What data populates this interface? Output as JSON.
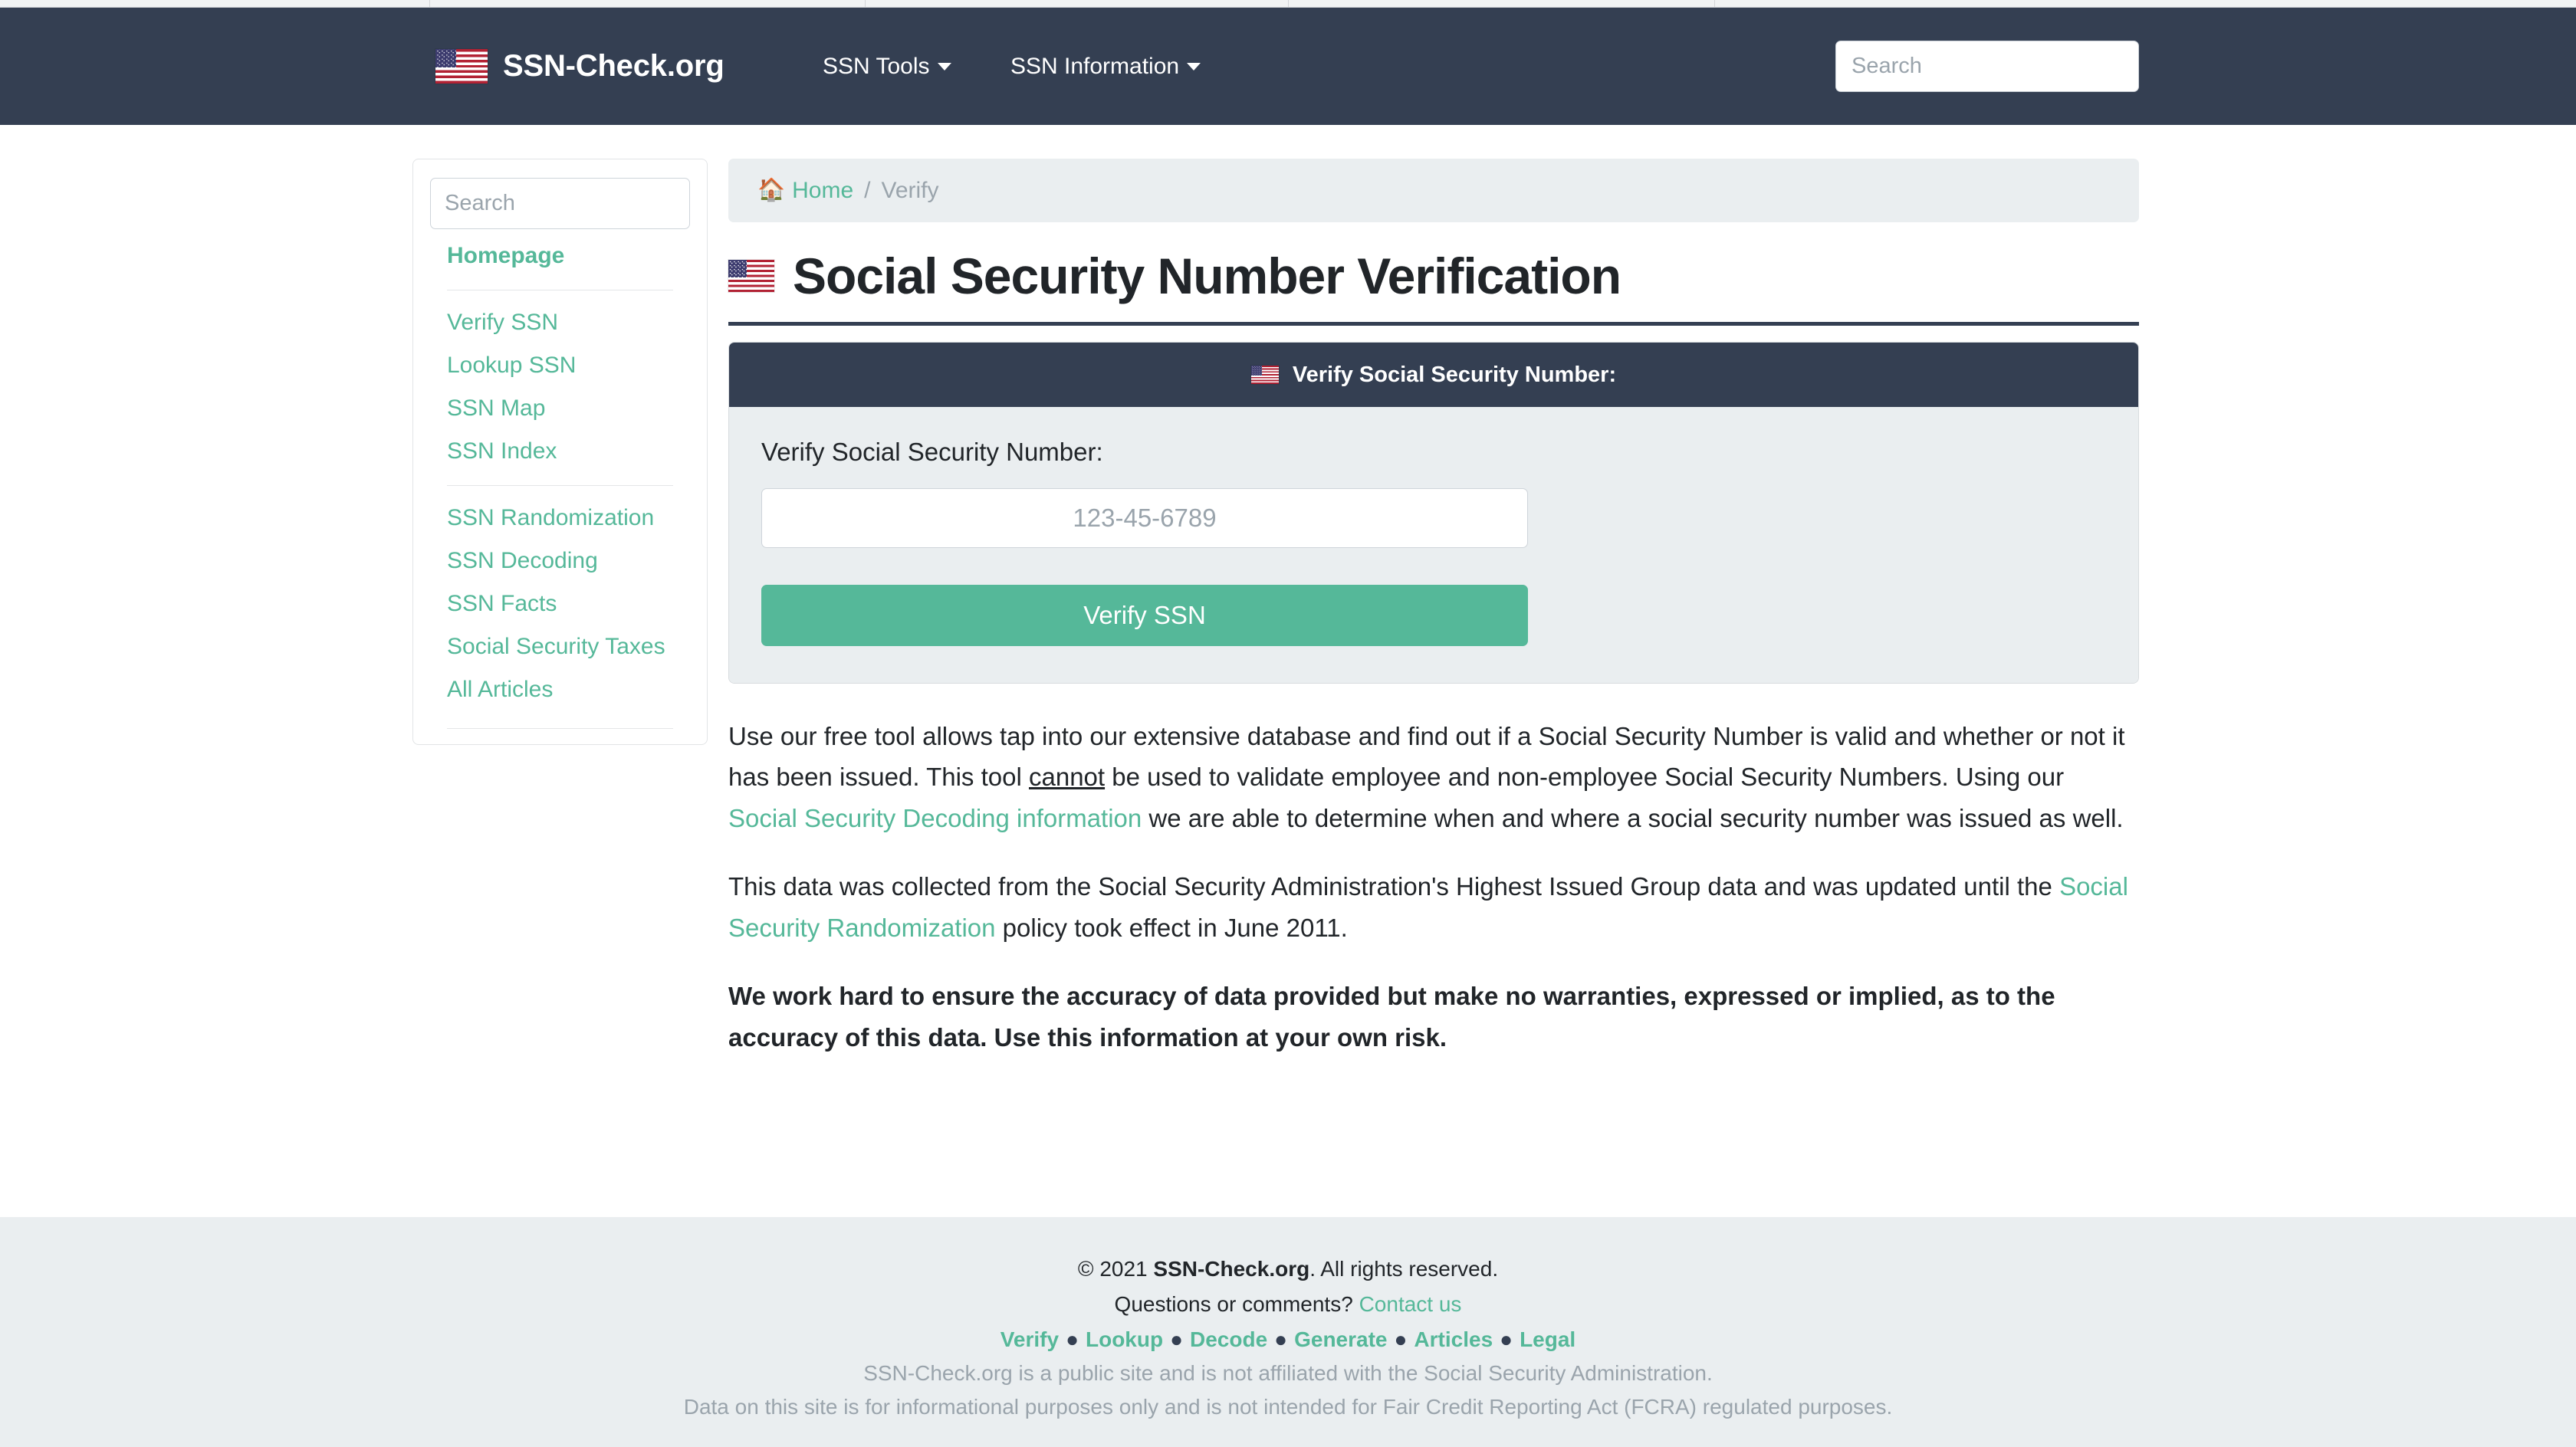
{
  "browser": {
    "tab_dividers": [
      560,
      1128,
      1680,
      2236
    ]
  },
  "navbar": {
    "brand": "SSN-Check.org",
    "brand_flag_icon": "us-flag-icon",
    "items": [
      {
        "label": "SSN Tools",
        "caret": "chevron-down-icon"
      },
      {
        "label": "SSN Information",
        "caret": "chevron-down-icon"
      }
    ],
    "search_placeholder": "Search",
    "search_value": "",
    "background": "#343f52"
  },
  "sidebar": {
    "search_placeholder": "Search",
    "search_value": "",
    "group1": [
      {
        "label": "Homepage",
        "bold": true
      }
    ],
    "group2": [
      {
        "label": "Verify SSN"
      },
      {
        "label": "Lookup SSN"
      },
      {
        "label": "SSN Map"
      },
      {
        "label": "SSN Index"
      }
    ],
    "group3": [
      {
        "label": "SSN Randomization"
      },
      {
        "label": "SSN Decoding"
      },
      {
        "label": "SSN Facts"
      },
      {
        "label": "Social Security Taxes"
      },
      {
        "label": "All Articles"
      }
    ]
  },
  "breadcrumb": {
    "home_icon": "home-icon",
    "home_label": "Home",
    "separator": "/",
    "current": "Verify"
  },
  "page": {
    "title": "Social Security Number Verification",
    "title_flag_icon": "us-flag-icon"
  },
  "verify_card": {
    "header_flag_icon": "us-flag-icon",
    "header_title": "Verify Social Security Number:",
    "field_label": "Verify Social Security Number:",
    "input_placeholder": "123-45-6789",
    "input_value": "",
    "submit_label": "Verify SSN",
    "accent_color": "#55b899"
  },
  "content": {
    "p1_a": "Use our free tool allows tap into our extensive database and find out if a Social Security Number is valid and whether or not it has been issued. This tool ",
    "p1_underline": "cannot",
    "p1_b": " be used to validate employee and non-employee Social Security Numbers. Using our ",
    "p1_link": "Social Security Decoding information",
    "p1_c": " we are able to determine when and where a social security number was issued as well.",
    "p2_a": "This data was collected from the Social Security Administration's Highest Issued Group data and was updated until the ",
    "p2_link": "Social Security Randomization",
    "p2_b": " policy took effect in June 2011.",
    "p3": "We work hard to ensure the accuracy of data provided but make no warranties, expressed or implied, as to the accuracy of this data. Use this information at your own risk."
  },
  "footer": {
    "copyright_pre": "© 2021 ",
    "copyright_brand": "SSN-Check.org",
    "copyright_post": ". All rights reserved.",
    "questions_text": "Questions or comments? ",
    "contact_label": "Contact us",
    "nav": [
      "Verify",
      "Lookup",
      "Decode",
      "Generate",
      "Articles",
      "Legal"
    ],
    "disclaimer1": "SSN-Check.org is a public site and is not affiliated with the Social Security Administration.",
    "disclaimer2": "Data on this site is for informational purposes only and is not intended for Fair Credit Reporting Act (FCRA) regulated purposes."
  }
}
